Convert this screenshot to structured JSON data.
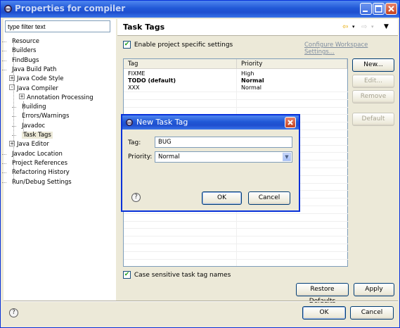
{
  "window": {
    "title": "Properties for compiler"
  },
  "filter": {
    "placeholder": "type filter text"
  },
  "tree": [
    {
      "label": "Resource"
    },
    {
      "label": "Builders"
    },
    {
      "label": "FindBugs"
    },
    {
      "label": "Java Build Path"
    },
    {
      "label": "Java Code Style",
      "expander": "+"
    },
    {
      "label": "Java Compiler",
      "expander": "-"
    },
    {
      "label": "Annotation Processing",
      "expander": "+"
    },
    {
      "label": "Building"
    },
    {
      "label": "Errors/Warnings"
    },
    {
      "label": "Javadoc"
    },
    {
      "label": "Task Tags",
      "selected": true
    },
    {
      "label": "Java Editor",
      "expander": "+"
    },
    {
      "label": "Javadoc Location"
    },
    {
      "label": "Project References"
    },
    {
      "label": "Refactoring History"
    },
    {
      "label": "Run/Debug Settings"
    }
  ],
  "page": {
    "title": "Task Tags",
    "enable_label": "Enable project specific settings",
    "configure_link": "Configure Workspace Settings...",
    "table": {
      "columns": [
        "Tag",
        "Priority"
      ],
      "rows": [
        {
          "tag": "FIXME",
          "priority": "High",
          "bold": false
        },
        {
          "tag": "TODO (default)",
          "priority": "Normal",
          "bold": true
        },
        {
          "tag": "XXX",
          "priority": "Normal",
          "bold": false
        }
      ]
    },
    "buttons": {
      "new": "New...",
      "edit": "Edit...",
      "remove": "Remove",
      "default": "Default"
    },
    "case_sensitive_label": "Case sensitive task tag names",
    "restore_defaults": "Restore Defaults",
    "apply": "Apply"
  },
  "dialog": {
    "title": "New Task Tag",
    "tag_label": "Tag:",
    "tag_value": "BUG",
    "priority_label": "Priority:",
    "priority_value": "Normal",
    "ok": "OK",
    "cancel": "Cancel"
  },
  "footer": {
    "ok": "OK",
    "cancel": "Cancel"
  },
  "colors": {
    "titlebar": "#2158d6",
    "dialog_bg": "#ece9d8",
    "accent": "#0831d9"
  }
}
